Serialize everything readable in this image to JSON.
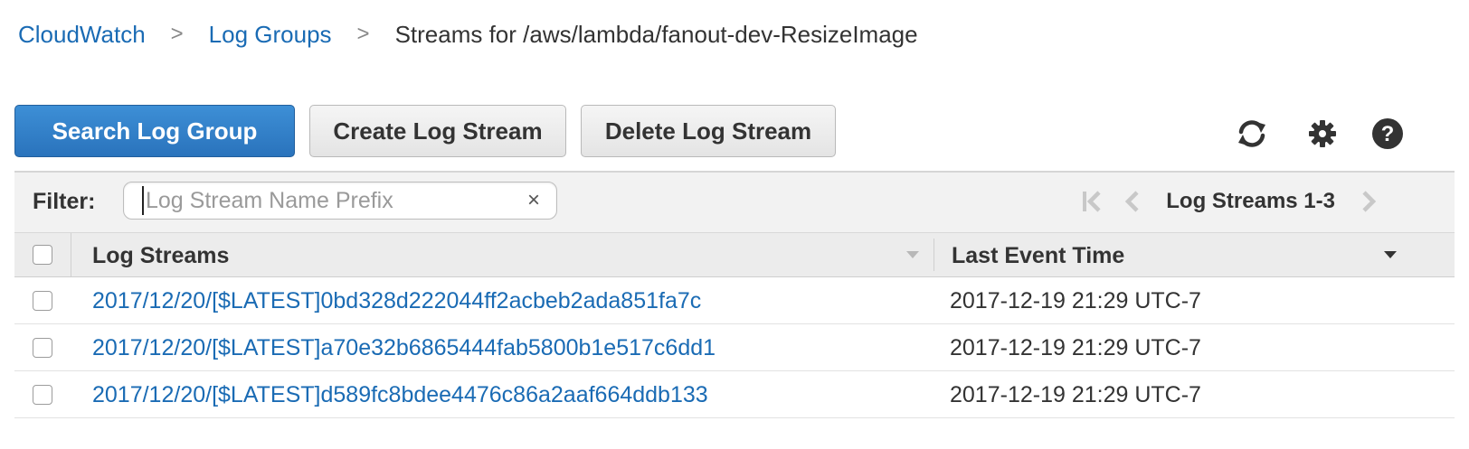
{
  "breadcrumb": {
    "root": "CloudWatch",
    "level1": "Log Groups",
    "current": "Streams for /aws/lambda/fanout-dev-ResizeImage",
    "separator": ">"
  },
  "toolbar": {
    "search_label": "Search Log Group",
    "create_label": "Create Log Stream",
    "delete_label": "Delete Log Stream",
    "icons": [
      "refresh-icon",
      "gear-icon",
      "help-icon"
    ]
  },
  "filter": {
    "label": "Filter:",
    "value": "",
    "placeholder": "Log Stream Name Prefix",
    "clear_glyph": "×"
  },
  "pager": {
    "text": "Log Streams 1-3"
  },
  "table": {
    "columns": [
      "Log Streams",
      "Last Event Time"
    ],
    "rows": [
      {
        "stream": "2017/12/20/[$LATEST]0bd328d222044ff2acbeb2ada851fa7c",
        "time": "2017-12-19 21:29 UTC-7"
      },
      {
        "stream": "2017/12/20/[$LATEST]a70e32b6865444fab5800b1e517c6dd1",
        "time": "2017-12-19 21:29 UTC-7"
      },
      {
        "stream": "2017/12/20/[$LATEST]d589fc8bdee4476c86a2aaf664ddb133",
        "time": "2017-12-19 21:29 UTC-7"
      }
    ]
  },
  "colors": {
    "link": "#1a6bb4",
    "primary_button": "#2a73bc",
    "text": "#333333",
    "disabled_icon": "#c8c8c8"
  }
}
